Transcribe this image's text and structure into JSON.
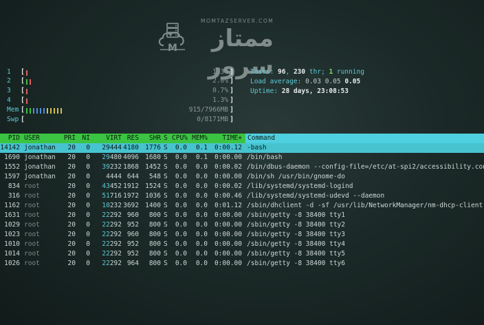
{
  "watermark": {
    "domain": "MOMTAZSERVER.COM",
    "name": "ممتاز سرور",
    "icon": "server-cloud-logo-icon"
  },
  "meters": [
    {
      "label": "1",
      "value": "1.3%",
      "bar_colors": [
        "#e06060"
      ]
    },
    {
      "label": "2",
      "value": "2.0%",
      "bar_colors": [
        "#3bc441",
        "#e06060"
      ]
    },
    {
      "label": "3",
      "value": "0.7%",
      "bar_colors": [
        "#e06060"
      ]
    },
    {
      "label": "4",
      "value": "1.3%",
      "bar_colors": [
        "#e06060"
      ]
    },
    {
      "label": "Mem",
      "value": "915/7966MB",
      "bar_colors": [
        "#3bc441",
        "#3bc441",
        "#4f8fe0",
        "#4f8fe0",
        "#4f8fe0",
        "#4f8fe0",
        "#d6c24a",
        "#d6c24a",
        "#d6c24a",
        "#d6c24a",
        "#d6c24a"
      ]
    },
    {
      "label": "Swp",
      "value": "0/8171MB",
      "bar_colors": []
    }
  ],
  "tasks": {
    "tasks_label": "Tasks: ",
    "tasks_count": "96",
    "threads_sep": ", ",
    "threads_count": "230",
    "threads_label": " thr; ",
    "running_count": "1",
    "running_label": " running",
    "load_label": "Load average: ",
    "load_1": "0.03",
    "load_5": "0.05",
    "load_15": "0.05",
    "uptime_label": "Uptime: ",
    "uptime_value": "28 days, 23:08:53"
  },
  "header": {
    "pid": "PID",
    "user": "USER",
    "pri": "PRI",
    "ni": "NI",
    "virt": "VIRT",
    "res": "RES",
    "shr": "SHR",
    "s": "S",
    "cpu": "CPU%",
    "mem": "MEM%",
    "time": "TIME+",
    "command": "Command"
  },
  "processes": [
    {
      "pid": "14142",
      "user": "jonathan",
      "pri": "20",
      "ni": "0",
      "virt_hi": "29",
      "virt_lo": "444",
      "res": "4180",
      "shr": "1776",
      "s": "S",
      "cpu": "0.0",
      "mem": "0.1",
      "time": "0:00.12",
      "command": "-bash",
      "selected": true
    },
    {
      "pid": "1690",
      "user": "jonathan",
      "pri": "20",
      "ni": "0",
      "virt_hi": "29",
      "virt_lo": "480",
      "res": "4096",
      "shr": "1680",
      "s": "S",
      "cpu": "0.0",
      "mem": "0.1",
      "time": "0:00.00",
      "command": "/bin/bash"
    },
    {
      "pid": "1552",
      "user": "jonathan",
      "pri": "20",
      "ni": "0",
      "virt_hi": "39",
      "virt_lo": "232",
      "res": "1868",
      "shr": "1452",
      "s": "S",
      "cpu": "0.0",
      "mem": "0.0",
      "time": "0:00.02",
      "command": "/bin/dbus-daemon --config-file=/etc/at-spi2/accessibility.con"
    },
    {
      "pid": "1597",
      "user": "jonathan",
      "pri": "20",
      "ni": "0",
      "virt_hi": "",
      "virt_lo": "4444",
      "res": "644",
      "shr": "548",
      "s": "S",
      "cpu": "0.0",
      "mem": "0.0",
      "time": "0:00.00",
      "command": "/bin/sh /usr/bin/gnome-do"
    },
    {
      "pid": "834",
      "user": "root",
      "pri": "20",
      "ni": "0",
      "virt_hi": "43",
      "virt_lo": "452",
      "res": "1912",
      "shr": "1524",
      "s": "S",
      "cpu": "0.0",
      "mem": "0.0",
      "time": "0:00.02",
      "command": "/lib/systemd/systemd-logind"
    },
    {
      "pid": "316",
      "user": "root",
      "pri": "20",
      "ni": "0",
      "virt_hi": "51",
      "virt_lo": "716",
      "res": "1972",
      "shr": "1036",
      "s": "S",
      "cpu": "0.0",
      "mem": "0.0",
      "time": "0:00.46",
      "command": "/lib/systemd/systemd-udevd --daemon"
    },
    {
      "pid": "1162",
      "user": "root",
      "pri": "20",
      "ni": "0",
      "virt_hi": "10",
      "virt_lo": "232",
      "res": "3692",
      "shr": "1400",
      "s": "S",
      "cpu": "0.0",
      "mem": "0.0",
      "time": "0:01.12",
      "command": "/sbin/dhclient -d -sf /usr/lib/NetworkManager/nm-dhcp-client."
    },
    {
      "pid": "1631",
      "user": "root",
      "pri": "20",
      "ni": "0",
      "virt_hi": "22",
      "virt_lo": "292",
      "res": "960",
      "shr": "800",
      "s": "S",
      "cpu": "0.0",
      "mem": "0.0",
      "time": "0:00.00",
      "command": "/sbin/getty -8 38400 tty1"
    },
    {
      "pid": "1029",
      "user": "root",
      "pri": "20",
      "ni": "0",
      "virt_hi": "22",
      "virt_lo": "292",
      "res": "952",
      "shr": "800",
      "s": "S",
      "cpu": "0.0",
      "mem": "0.0",
      "time": "0:00.00",
      "command": "/sbin/getty -8 38400 tty2"
    },
    {
      "pid": "1023",
      "user": "root",
      "pri": "20",
      "ni": "0",
      "virt_hi": "22",
      "virt_lo": "292",
      "res": "960",
      "shr": "800",
      "s": "S",
      "cpu": "0.0",
      "mem": "0.0",
      "time": "0:00.00",
      "command": "/sbin/getty -8 38400 tty3"
    },
    {
      "pid": "1010",
      "user": "root",
      "pri": "20",
      "ni": "0",
      "virt_hi": "22",
      "virt_lo": "292",
      "res": "952",
      "shr": "800",
      "s": "S",
      "cpu": "0.0",
      "mem": "0.0",
      "time": "0:00.00",
      "command": "/sbin/getty -8 38400 tty4"
    },
    {
      "pid": "1014",
      "user": "root",
      "pri": "20",
      "ni": "0",
      "virt_hi": "22",
      "virt_lo": "292",
      "res": "952",
      "shr": "800",
      "s": "S",
      "cpu": "0.0",
      "mem": "0.0",
      "time": "0:00.00",
      "command": "/sbin/getty -8 38400 tty5"
    },
    {
      "pid": "1026",
      "user": "root",
      "pri": "20",
      "ni": "0",
      "virt_hi": "22",
      "virt_lo": "292",
      "res": "964",
      "shr": "800",
      "s": "S",
      "cpu": "0.0",
      "mem": "0.0",
      "time": "0:00.00",
      "command": "/sbin/getty -8 38400 tty6"
    }
  ]
}
